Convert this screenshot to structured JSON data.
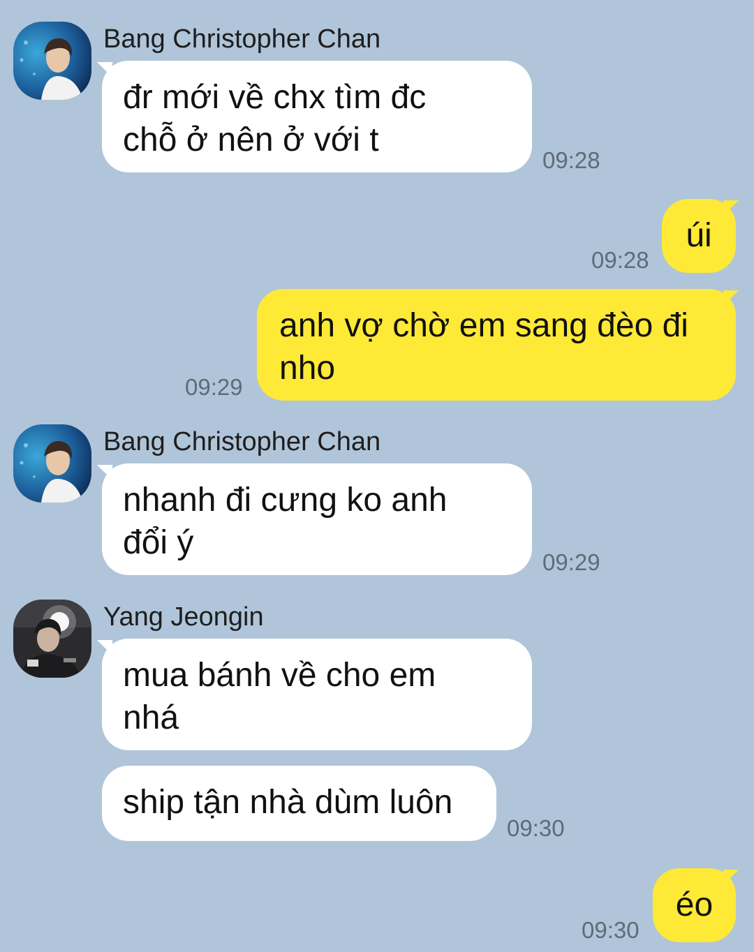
{
  "colors": {
    "background": "#b0c5d9",
    "incoming_bubble": "#ffffff",
    "outgoing_bubble": "#fee936",
    "timestamp": "#5f6b77"
  },
  "messages": [
    {
      "sender": "Bang Christopher Chan",
      "avatar": "profile-photo-chan",
      "text": "đr mới về chx tìm đc\nchỗ ở nên ở với t",
      "time": "09:28"
    },
    {
      "text": "úi",
      "time": "09:28"
    },
    {
      "text": "anh vợ chờ em sang đèo đi\nnho",
      "time": "09:29"
    },
    {
      "sender": "Bang Christopher Chan",
      "avatar": "profile-photo-chan",
      "text": "nhanh đi cưng ko anh\nđổi ý",
      "time": "09:29"
    },
    {
      "sender": "Yang Jeongin",
      "avatar": "profile-photo-jeongin",
      "text": "mua bánh về cho em\nnhá"
    },
    {
      "text": "ship tận nhà dùm luôn",
      "time": "09:30"
    },
    {
      "text": "éo",
      "time": "09:30"
    }
  ]
}
